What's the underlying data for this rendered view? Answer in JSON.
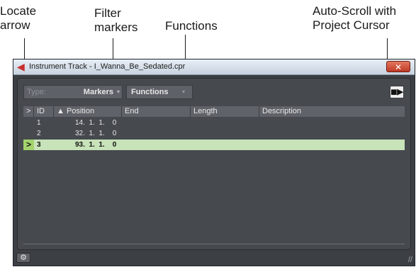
{
  "callouts": {
    "locate_arrow": "Locate\narrow",
    "filter_markers": "Filter\nmarkers",
    "functions": "Functions",
    "auto_scroll": "Auto-Scroll with\nProject Cursor"
  },
  "window": {
    "title": "Instrument Track - I_Wanna_Be_Sedated.cpr",
    "close_glyph": "✕"
  },
  "toolbar": {
    "type_label": "Type:",
    "type_value": "Markers",
    "functions_label": "Functions",
    "caret": "▾",
    "autoscroll_glyph": "◼▶"
  },
  "table": {
    "columns": [
      ">",
      "ID",
      "▲ Position",
      "End",
      "Length",
      "Description"
    ],
    "rows": [
      {
        "locate": "",
        "id": "1",
        "position": "14.  1.  1.    0",
        "end": "",
        "length": "",
        "description": "",
        "selected": false
      },
      {
        "locate": "",
        "id": "2",
        "position": "32.  1.  1.    0",
        "end": "",
        "length": "",
        "description": "",
        "selected": false
      },
      {
        "locate": ">",
        "id": "3",
        "position": "93.  1.  1.    0",
        "end": "",
        "length": "",
        "description": "",
        "selected": true
      }
    ]
  },
  "bottom": {
    "gear_glyph": "⚙",
    "grip_glyph": "//"
  },
  "colors": {
    "selected_row": "#c8e2b9",
    "locate_arrow_bg": "#a3d36d",
    "close_button": "#c03a26"
  }
}
